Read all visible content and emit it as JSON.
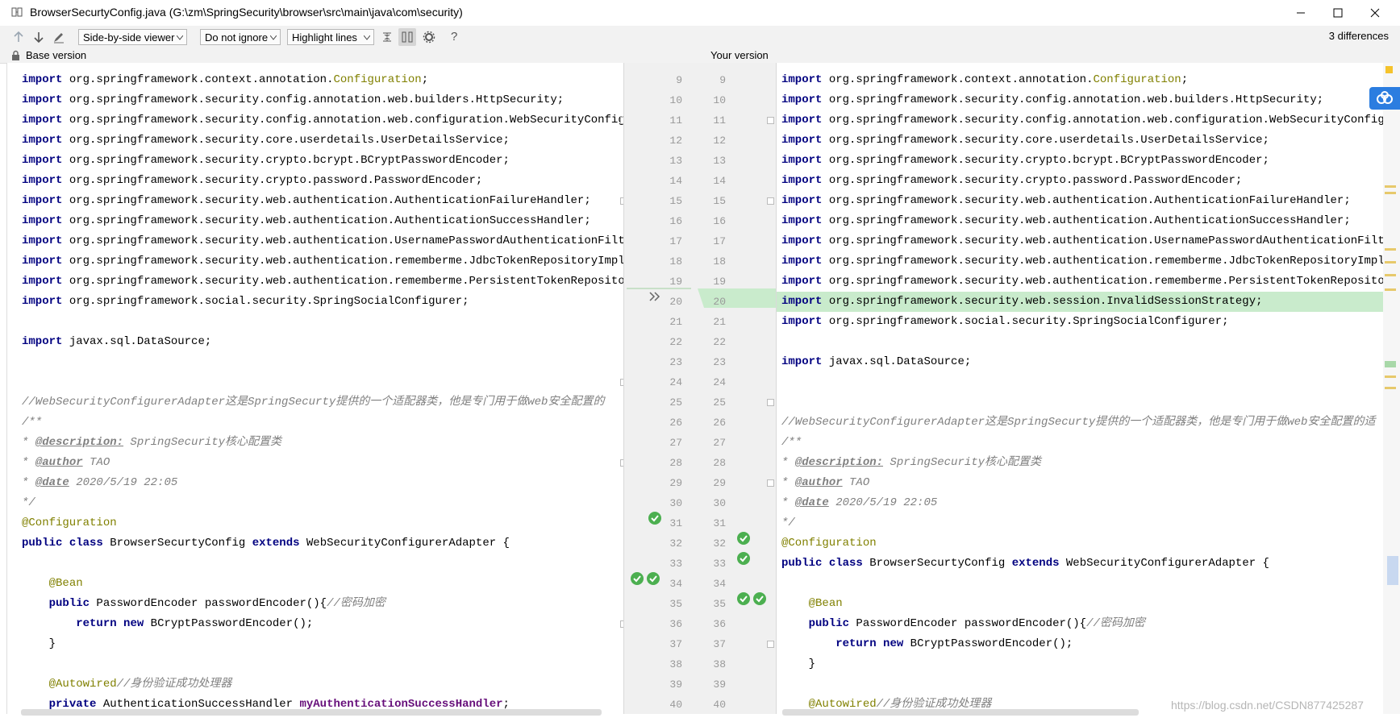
{
  "window": {
    "title": "BrowserSecurtyConfig.java (G:\\zm\\SpringSecurity\\browser\\src\\main\\java\\com\\security)",
    "minimize_icon": "minimize-icon",
    "maximize_icon": "maximize-icon",
    "close_icon": "close-icon"
  },
  "toolbar": {
    "viewer": "Side-by-side viewer",
    "ignore": "Do not ignore",
    "highlight": "Highlight lines",
    "help": "?",
    "diff_count": "3 differences"
  },
  "labels": {
    "left": "Base version",
    "right": "Your version"
  },
  "colors": {
    "keyword": "#000080",
    "annotation": "#808000",
    "comment": "#808080",
    "field": "#660e7a",
    "inserted_bg": "#c9ebcc",
    "gutter_bg": "#f0f0f0"
  },
  "left_lines": [
    {
      "n": "9",
      "parts": [
        {
          "t": "import",
          "c": "kw"
        },
        {
          "t": " org.springframework.context.annotation."
        },
        {
          "t": "Configuration",
          "c": "ann"
        },
        {
          "t": ";"
        }
      ]
    },
    {
      "n": "10",
      "parts": [
        {
          "t": "import",
          "c": "kw"
        },
        {
          "t": " org.springframework.security.config.annotation.web.builders.HttpSecurity;"
        }
      ]
    },
    {
      "n": "11",
      "parts": [
        {
          "t": "import",
          "c": "kw"
        },
        {
          "t": " org.springframework.security.config.annotation.web.configuration.WebSecurityConfigurer"
        }
      ]
    },
    {
      "n": "12",
      "parts": [
        {
          "t": "import",
          "c": "kw"
        },
        {
          "t": " org.springframework.security.core.userdetails.UserDetailsService;"
        }
      ]
    },
    {
      "n": "13",
      "parts": [
        {
          "t": "import",
          "c": "kw"
        },
        {
          "t": " org.springframework.security.crypto.bcrypt.BCryptPasswordEncoder;"
        }
      ]
    },
    {
      "n": "14",
      "parts": [
        {
          "t": "import",
          "c": "kw"
        },
        {
          "t": " org.springframework.security.crypto.password.PasswordEncoder;"
        }
      ]
    },
    {
      "n": "15",
      "parts": [
        {
          "t": "import",
          "c": "kw"
        },
        {
          "t": " org.springframework.security.web.authentication.AuthenticationFailureHandler;"
        }
      ]
    },
    {
      "n": "16",
      "parts": [
        {
          "t": "import",
          "c": "kw"
        },
        {
          "t": " org.springframework.security.web.authentication.AuthenticationSuccessHandler;"
        }
      ]
    },
    {
      "n": "17",
      "parts": [
        {
          "t": "import",
          "c": "kw"
        },
        {
          "t": " org.springframework.security.web.authentication.UsernamePasswordAuthenticationFilter;"
        }
      ]
    },
    {
      "n": "18",
      "parts": [
        {
          "t": "import",
          "c": "kw"
        },
        {
          "t": " org.springframework.security.web.authentication.rememberme.JdbcTokenRepositoryImpl;"
        }
      ]
    },
    {
      "n": "19",
      "parts": [
        {
          "t": "import",
          "c": "kw"
        },
        {
          "t": " org.springframework.security.web.authentication.rememberme.PersistentTokenRepository;"
        }
      ]
    },
    {
      "n": "20",
      "parts": [
        {
          "t": "import",
          "c": "kw"
        },
        {
          "t": " org.springframework.social.security.SpringSocialConfigurer;"
        }
      ]
    },
    {
      "n": "21",
      "parts": []
    },
    {
      "n": "22",
      "parts": [
        {
          "t": "import",
          "c": "kw"
        },
        {
          "t": " javax.sql.DataSource;"
        }
      ]
    },
    {
      "n": "23",
      "parts": []
    },
    {
      "n": "24",
      "parts": []
    },
    {
      "n": "25",
      "parts": [
        {
          "t": "//WebSecurityConfigurerAdapter这是SpringSecurty提供的一个适配器类，他是专门用于做web安全配置的",
          "c": "cmt"
        }
      ]
    },
    {
      "n": "26",
      "parts": [
        {
          "t": "/**",
          "c": "cmt"
        }
      ]
    },
    {
      "n": "27",
      "parts": [
        {
          "t": "* ",
          "c": "cmt"
        },
        {
          "t": "@description:",
          "c": "doctag"
        },
        {
          "t": " SpringSecurity核心配置类",
          "c": "cmt"
        }
      ]
    },
    {
      "n": "28",
      "parts": [
        {
          "t": "* ",
          "c": "cmt"
        },
        {
          "t": "@author",
          "c": "doctag"
        },
        {
          "t": " TAO",
          "c": "cmt"
        }
      ]
    },
    {
      "n": "29",
      "parts": [
        {
          "t": "* ",
          "c": "cmt"
        },
        {
          "t": "@date",
          "c": "doctag"
        },
        {
          "t": " 2020/5/19 22:05",
          "c": "cmt"
        }
      ]
    },
    {
      "n": "30",
      "parts": [
        {
          "t": "*/",
          "c": "cmt"
        }
      ]
    },
    {
      "n": "31",
      "parts": [
        {
          "t": "@Configuration",
          "c": "ann"
        }
      ]
    },
    {
      "n": "32",
      "parts": [
        {
          "t": "public",
          "c": "kw"
        },
        {
          "t": " "
        },
        {
          "t": "class",
          "c": "kw"
        },
        {
          "t": " BrowserSecurtyConfig "
        },
        {
          "t": "extends",
          "c": "kw"
        },
        {
          "t": " WebSecurityConfigurerAdapter {"
        }
      ]
    },
    {
      "n": "33",
      "parts": []
    },
    {
      "n": "34",
      "parts": [
        {
          "t": "    "
        },
        {
          "t": "@Bean",
          "c": "ann"
        }
      ]
    },
    {
      "n": "35",
      "parts": [
        {
          "t": "    "
        },
        {
          "t": "public",
          "c": "kw"
        },
        {
          "t": " PasswordEncoder passwordEncoder(){"
        },
        {
          "t": "//密码加密",
          "c": "cmt"
        }
      ]
    },
    {
      "n": "36",
      "parts": [
        {
          "t": "        "
        },
        {
          "t": "return",
          "c": "kw"
        },
        {
          "t": " "
        },
        {
          "t": "new",
          "c": "kw"
        },
        {
          "t": " BCryptPasswordEncoder();"
        }
      ]
    },
    {
      "n": "37",
      "parts": [
        {
          "t": "    }"
        }
      ]
    },
    {
      "n": "38",
      "parts": []
    },
    {
      "n": "39",
      "parts": [
        {
          "t": "    "
        },
        {
          "t": "@Autowired",
          "c": "ann"
        },
        {
          "t": "//身份验证成功处理器",
          "c": "cmt"
        }
      ]
    },
    {
      "n": "40",
      "parts": [
        {
          "t": "    "
        },
        {
          "t": "private",
          "c": "kw"
        },
        {
          "t": " AuthenticationSuccessHandler "
        },
        {
          "t": "myAuthenticationSuccessHandler",
          "c": "field"
        },
        {
          "t": ";"
        }
      ]
    }
  ],
  "right_lines": [
    {
      "n": "9",
      "parts": [
        {
          "t": "import",
          "c": "kw"
        },
        {
          "t": " org.springframework.context.annotation."
        },
        {
          "t": "Configuration",
          "c": "ann"
        },
        {
          "t": ";"
        }
      ]
    },
    {
      "n": "10",
      "parts": [
        {
          "t": "import",
          "c": "kw"
        },
        {
          "t": " org.springframework.security.config.annotation.web.builders.HttpSecurity;"
        }
      ]
    },
    {
      "n": "11",
      "parts": [
        {
          "t": "import",
          "c": "kw"
        },
        {
          "t": " org.springframework.security.config.annotation.web.configuration.WebSecurityConfigurerAd"
        }
      ]
    },
    {
      "n": "12",
      "parts": [
        {
          "t": "import",
          "c": "kw"
        },
        {
          "t": " org.springframework.security.core.userdetails.UserDetailsService;"
        }
      ]
    },
    {
      "n": "13",
      "parts": [
        {
          "t": "import",
          "c": "kw"
        },
        {
          "t": " org.springframework.security.crypto.bcrypt.BCryptPasswordEncoder;"
        }
      ]
    },
    {
      "n": "14",
      "parts": [
        {
          "t": "import",
          "c": "kw"
        },
        {
          "t": " org.springframework.security.crypto.password.PasswordEncoder;"
        }
      ]
    },
    {
      "n": "15",
      "parts": [
        {
          "t": "import",
          "c": "kw"
        },
        {
          "t": " org.springframework.security.web.authentication.AuthenticationFailureHandler;"
        }
      ]
    },
    {
      "n": "16",
      "parts": [
        {
          "t": "import",
          "c": "kw"
        },
        {
          "t": " org.springframework.security.web.authentication.AuthenticationSuccessHandler;"
        }
      ]
    },
    {
      "n": "17",
      "parts": [
        {
          "t": "import",
          "c": "kw"
        },
        {
          "t": " org.springframework.security.web.authentication.UsernamePasswordAuthenticationFilter;"
        }
      ]
    },
    {
      "n": "18",
      "parts": [
        {
          "t": "import",
          "c": "kw"
        },
        {
          "t": " org.springframework.security.web.authentication.rememberme.JdbcTokenRepositoryImpl;"
        }
      ]
    },
    {
      "n": "19",
      "parts": [
        {
          "t": "import",
          "c": "kw"
        },
        {
          "t": " org.springframework.security.web.authentication.rememberme.PersistentTokenRepository;"
        }
      ]
    },
    {
      "n": "20",
      "inserted": true,
      "parts": [
        {
          "t": "import",
          "c": "kw"
        },
        {
          "t": " org.springframework.security.web.session.InvalidSessionStrategy;"
        }
      ]
    },
    {
      "n": "21",
      "parts": [
        {
          "t": "import",
          "c": "kw"
        },
        {
          "t": " org.springframework.social.security.SpringSocialConfigurer;"
        }
      ]
    },
    {
      "n": "22",
      "parts": []
    },
    {
      "n": "23",
      "parts": [
        {
          "t": "import",
          "c": "kw"
        },
        {
          "t": " javax.sql.DataSource;"
        }
      ]
    },
    {
      "n": "24",
      "parts": []
    },
    {
      "n": "25",
      "parts": []
    },
    {
      "n": "26",
      "parts": [
        {
          "t": "//WebSecurityConfigurerAdapter这是SpringSecurty提供的一个适配器类，他是专门用于做web安全配置的适",
          "c": "cmt"
        }
      ]
    },
    {
      "n": "27",
      "parts": [
        {
          "t": "/**",
          "c": "cmt"
        }
      ]
    },
    {
      "n": "28",
      "parts": [
        {
          "t": "* ",
          "c": "cmt"
        },
        {
          "t": "@description:",
          "c": "doctag"
        },
        {
          "t": " SpringSecurity核心配置类",
          "c": "cmt"
        }
      ]
    },
    {
      "n": "29",
      "parts": [
        {
          "t": "* ",
          "c": "cmt"
        },
        {
          "t": "@author",
          "c": "doctag"
        },
        {
          "t": " TAO",
          "c": "cmt"
        }
      ]
    },
    {
      "n": "30",
      "parts": [
        {
          "t": "* ",
          "c": "cmt"
        },
        {
          "t": "@date",
          "c": "doctag"
        },
        {
          "t": " 2020/5/19 22:05",
          "c": "cmt"
        }
      ]
    },
    {
      "n": "31",
      "parts": [
        {
          "t": "*/",
          "c": "cmt"
        }
      ]
    },
    {
      "n": "32",
      "parts": [
        {
          "t": "@Configuration",
          "c": "ann"
        }
      ]
    },
    {
      "n": "33",
      "parts": [
        {
          "t": "public",
          "c": "kw"
        },
        {
          "t": " "
        },
        {
          "t": "class",
          "c": "kw"
        },
        {
          "t": " BrowserSecurtyConfig "
        },
        {
          "t": "extends",
          "c": "kw"
        },
        {
          "t": " WebSecurityConfigurerAdapter {"
        }
      ]
    },
    {
      "n": "34",
      "parts": []
    },
    {
      "n": "35",
      "parts": [
        {
          "t": "    "
        },
        {
          "t": "@Bean",
          "c": "ann"
        }
      ]
    },
    {
      "n": "36",
      "parts": [
        {
          "t": "    "
        },
        {
          "t": "public",
          "c": "kw"
        },
        {
          "t": " PasswordEncoder passwordEncoder(){"
        },
        {
          "t": "//密码加密",
          "c": "cmt"
        }
      ]
    },
    {
      "n": "37",
      "parts": [
        {
          "t": "        "
        },
        {
          "t": "return",
          "c": "kw"
        },
        {
          "t": " "
        },
        {
          "t": "new",
          "c": "kw"
        },
        {
          "t": " BCryptPasswordEncoder();"
        }
      ]
    },
    {
      "n": "38",
      "parts": [
        {
          "t": "    }"
        }
      ]
    },
    {
      "n": "39",
      "parts": []
    },
    {
      "n": "40",
      "parts": [
        {
          "t": "    "
        },
        {
          "t": "@Autowired",
          "c": "ann"
        },
        {
          "t": "//身份验证成功处理器",
          "c": "cmt"
        }
      ]
    }
  ],
  "gutter_numbers": {
    "left": [
      "9",
      "10",
      "11",
      "12",
      "13",
      "14",
      "15",
      "16",
      "17",
      "18",
      "19",
      "20",
      "21",
      "22",
      "23",
      "24",
      "25",
      "26",
      "27",
      "28",
      "29",
      "30",
      "31",
      "32",
      "33",
      "34",
      "35",
      "36",
      "37",
      "38",
      "39",
      "40"
    ],
    "right": [
      "9",
      "10",
      "11",
      "12",
      "13",
      "14",
      "15",
      "16",
      "17",
      "18",
      "19",
      "20",
      "21",
      "22",
      "23",
      "24",
      "25",
      "26",
      "27",
      "28",
      "29",
      "30",
      "31",
      "32",
      "33",
      "34",
      "35",
      "36",
      "37",
      "38",
      "39",
      "40"
    ]
  },
  "watermark": "https://blog.csdn.net/CSDN877425287"
}
